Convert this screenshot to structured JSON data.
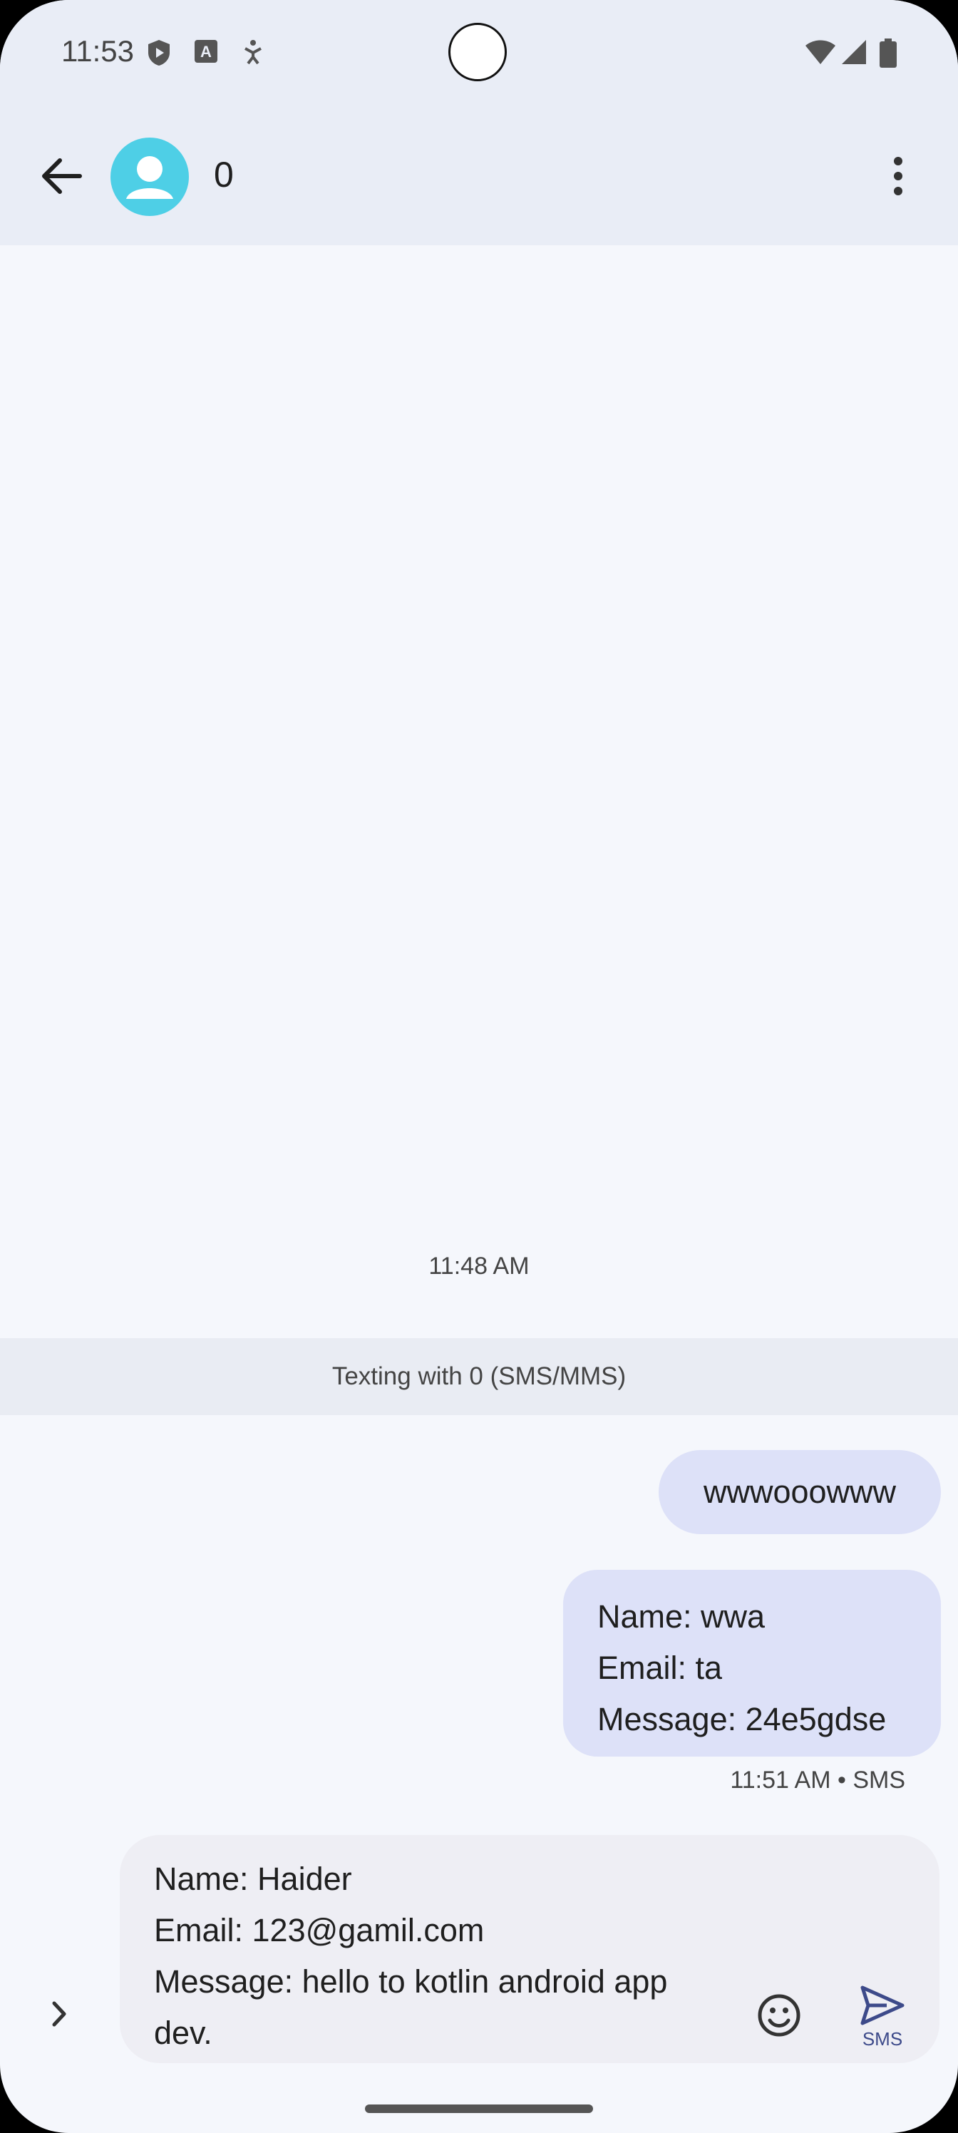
{
  "status": {
    "time": "11:53"
  },
  "header": {
    "contact_name": "0"
  },
  "thread": {
    "timestamp": "11:48 AM",
    "texting_with": "Texting with 0 (SMS/MMS)",
    "messages": [
      {
        "lines": [
          "wwwooowww"
        ]
      },
      {
        "lines": [
          "Name: wwa",
          "Email: ta",
          "Message: 24e5gdse"
        ]
      }
    ],
    "last_meta": "11:51 AM • SMS"
  },
  "compose": {
    "lines": [
      "Name: Haider",
      "Email: 123@gamil.com",
      "Message: hello to kotlin android app",
      "dev."
    ],
    "send_label": "SMS"
  },
  "colors": {
    "accent": "#3d4a8a",
    "avatar": "#4ecfe6",
    "bubble": "#dde1f8"
  },
  "icons": [
    "shield-play-icon",
    "keyboard-a-icon",
    "accessibility-icon",
    "wifi-icon",
    "signal-icon",
    "battery-icon",
    "back-arrow-icon",
    "person-icon",
    "more-vert-icon",
    "chevron-right-icon",
    "emoji-icon",
    "send-icon"
  ]
}
